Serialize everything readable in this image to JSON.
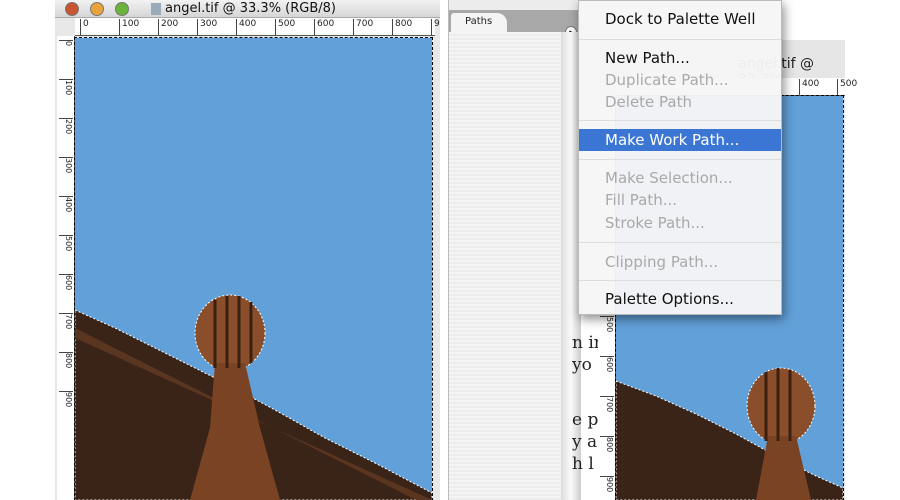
{
  "document": {
    "title": "angel.tif @ 33.3% (RGB/8)",
    "hruler": [
      "0",
      "100",
      "200",
      "300",
      "400",
      "500",
      "600",
      "700",
      "800",
      "9"
    ],
    "vruler": [
      "0",
      "100",
      "200",
      "300",
      "400",
      "500",
      "600",
      "700",
      "800",
      "900"
    ],
    "canvas_color": "#62a0d9"
  },
  "palette": {
    "tab": "Paths",
    "menu_button_icon": "triangle-right-icon"
  },
  "document2": {
    "title": "angel.tif @ 33.3%",
    "hruler": [
      "400",
      "500"
    ],
    "vruler": [
      "500",
      "600",
      "700",
      "800",
      "900"
    ]
  },
  "menu": {
    "items": [
      {
        "label": "Dock to Palette Well",
        "enabled": true
      },
      {
        "label": "New Path...",
        "enabled": true
      },
      {
        "label": "Duplicate Path...",
        "enabled": false
      },
      {
        "label": "Delete Path",
        "enabled": false
      },
      {
        "label": "Make Work Path...",
        "enabled": true,
        "highlighted": true
      },
      {
        "label": "Make Selection...",
        "enabled": false
      },
      {
        "label": "Fill Path...",
        "enabled": false
      },
      {
        "label": "Stroke Path...",
        "enabled": false
      },
      {
        "label": "Clipping Path...",
        "enabled": false
      },
      {
        "label": "Palette Options...",
        "enabled": true
      }
    ],
    "highlight_color": "#3b76d4"
  },
  "background_text": [
    "n ir",
    "yo",
    "e p",
    "y a",
    "h l"
  ]
}
